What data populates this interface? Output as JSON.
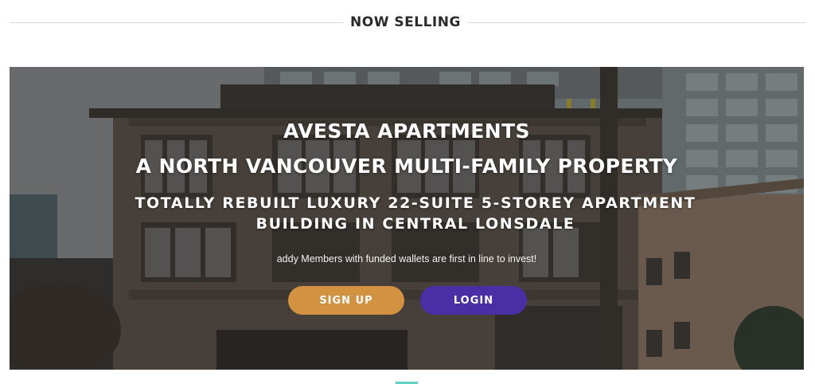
{
  "section": {
    "title": "NOW SELLING"
  },
  "hero": {
    "title": "AVESTA APARTMENTS",
    "subtitle": "A NORTH VANCOUVER MULTI-FAMILY PROPERTY",
    "description": "TOTALLY REBUILT LUXURY 22-SUITE 5-STOREY APARTMENT BUILDING IN CENTRAL LONSDALE",
    "note": "addy Members with funded wallets are first in line to invest!",
    "buttons": {
      "signup": "SIGN UP",
      "login": "LOGIN"
    }
  },
  "colors": {
    "signup": "#d39142",
    "login": "#4a2ea6",
    "accent": "#5fd3c0"
  }
}
